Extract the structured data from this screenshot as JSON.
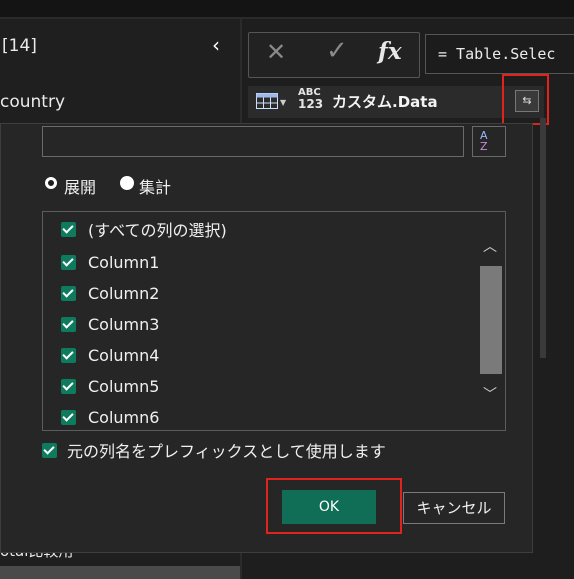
{
  "queries_pane": {
    "title": "[14]",
    "collapse_glyph": "‹",
    "items": [
      "country",
      "otal比較用"
    ]
  },
  "formula_bar": {
    "cancel_glyph": "✕",
    "commit_glyph": "✓",
    "fx_label": "fx",
    "formula": "= Table.Selec"
  },
  "column_header": {
    "type_icon_top": "ABC",
    "type_icon_bottom": "123",
    "name": "カスタム.Data",
    "expand_glyph": "⇆"
  },
  "expand_dialog": {
    "search_value": "",
    "sort_icon_top": "A",
    "sort_icon_bottom": "Z",
    "mode_options": [
      "展開",
      "集計"
    ],
    "selected_mode": "展開",
    "columns": [
      {
        "label": "(すべての列の選択)",
        "checked": true
      },
      {
        "label": "Column1",
        "checked": true
      },
      {
        "label": "Column2",
        "checked": true
      },
      {
        "label": "Column3",
        "checked": true
      },
      {
        "label": "Column4",
        "checked": true
      },
      {
        "label": "Column5",
        "checked": true
      },
      {
        "label": "Column6",
        "checked": true
      }
    ],
    "use_prefix_label": "元の列名をプレフィックスとして使用します",
    "use_prefix_checked": true,
    "ok_label": "OK",
    "cancel_label": "キャンセル"
  },
  "colors": {
    "accent_green": "#0f6e55",
    "highlight_red": "#e0231d",
    "background": "#1e1e1e",
    "dialog_background": "#262626"
  },
  "icons": [
    "close-icon",
    "check-icon",
    "fx-icon",
    "table-icon",
    "abc-123-type-icon",
    "expand-columns-icon",
    "sort-az-icon",
    "chevron-up-icon",
    "chevron-down-icon",
    "chevron-left-icon"
  ]
}
